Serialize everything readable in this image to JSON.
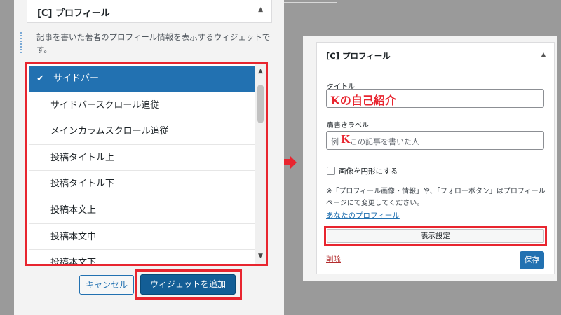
{
  "left_panel": {
    "widget_title": "[C] プロフィール",
    "description": "記事を書いた著者のプロフィール情報を表示するウィジェットです。",
    "locations": [
      {
        "label": "サイドバー",
        "selected": true
      },
      {
        "label": "サイドバースクロール追従",
        "selected": false
      },
      {
        "label": "メインカラムスクロール追従",
        "selected": false
      },
      {
        "label": "投稿タイトル上",
        "selected": false
      },
      {
        "label": "投稿タイトル下",
        "selected": false
      },
      {
        "label": "投稿本文上",
        "selected": false
      },
      {
        "label": "投稿本文中",
        "selected": false
      },
      {
        "label": "投稿本文下",
        "selected": false
      }
    ],
    "cancel_label": "キャンセル",
    "add_widget_label": "ウィジェットを追加"
  },
  "right_panel": {
    "widget_title": "[C] プロフィール",
    "title_label": "タイトル",
    "title_value": "Kの自己紹介",
    "shoulder_label": "肩書きラベル",
    "shoulder_value_prefix": "例",
    "shoulder_value_k": "K",
    "shoulder_value_rest": "この記事を書いた人",
    "circle_image_label": "画像を円形にする",
    "note": "※「プロフィール画像・情報」や、「フォローボタン」はプロフィールページにて変更してください。",
    "profile_link": "あなたのプロフィール",
    "display_settings_label": "表示設定",
    "delete_label": "削除",
    "save_label": "保存"
  },
  "colors": {
    "highlight_red": "#e8252f",
    "wp_blue": "#2271b1",
    "wp_blue_dark": "#135e96"
  }
}
